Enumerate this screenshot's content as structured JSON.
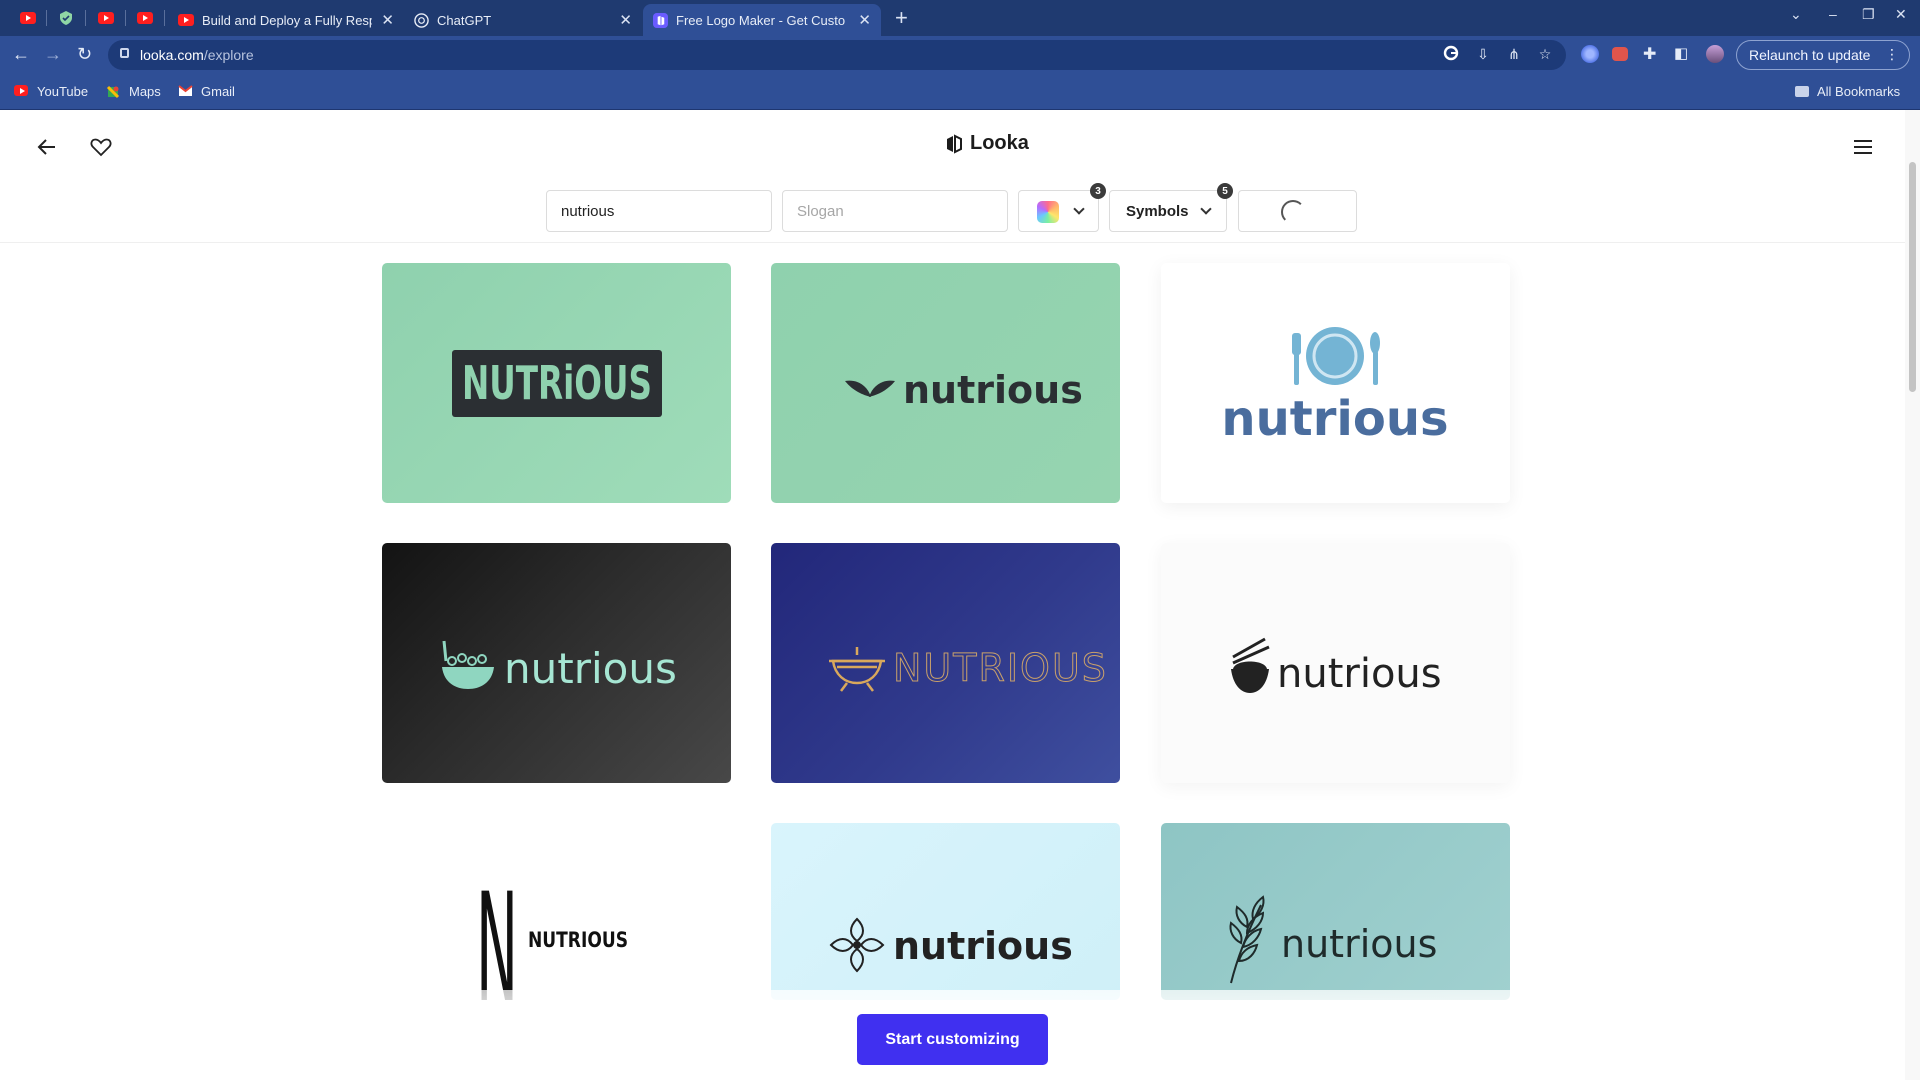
{
  "browser": {
    "tabs": [
      {
        "label": "Build and Deploy a Fully Resp",
        "favicon": "youtube-icon"
      },
      {
        "label": "ChatGPT",
        "favicon": "chatgpt-icon"
      },
      {
        "label": "Free Logo Maker - Get Custo",
        "favicon": "looka-icon",
        "active": true
      }
    ],
    "url_host": "looka.com",
    "url_path": "/explore",
    "relaunch_label": "Relaunch to update",
    "bookmarks": [
      {
        "label": "YouTube",
        "icon": "youtube-icon"
      },
      {
        "label": "Maps",
        "icon": "maps-icon"
      },
      {
        "label": "Gmail",
        "icon": "gmail-icon"
      }
    ],
    "all_bookmarks_label": "All Bookmarks"
  },
  "header": {
    "brand": "Looka"
  },
  "filters": {
    "company_name_value": "nutrious",
    "slogan_placeholder": "Slogan",
    "colors_count": "3",
    "symbols_label": "Symbols",
    "symbols_count": "5"
  },
  "logos": [
    {
      "text": "NUTRiOUS",
      "style": "block-badge"
    },
    {
      "text": "nutrious",
      "style": "wings-symbol"
    },
    {
      "text": "nutrious",
      "style": "plate-symbol"
    },
    {
      "text": "nutrious",
      "style": "salad-bowl-symbol"
    },
    {
      "text": "NUTRIOUS",
      "style": "grill-symbol"
    },
    {
      "text": "nutrious",
      "style": "rice-bowl-symbol"
    },
    {
      "text": "NUTRIOUS",
      "monogram": "N",
      "style": "monogram"
    },
    {
      "text": "nutrious",
      "style": "ornament-symbol"
    },
    {
      "text": "nutrious",
      "style": "leaf-symbol"
    }
  ],
  "cta_label": "Start customizing",
  "colors": {
    "chrome_dark": "#1f3a70",
    "chrome": "#2f4f96",
    "accent": "#4030f0"
  }
}
